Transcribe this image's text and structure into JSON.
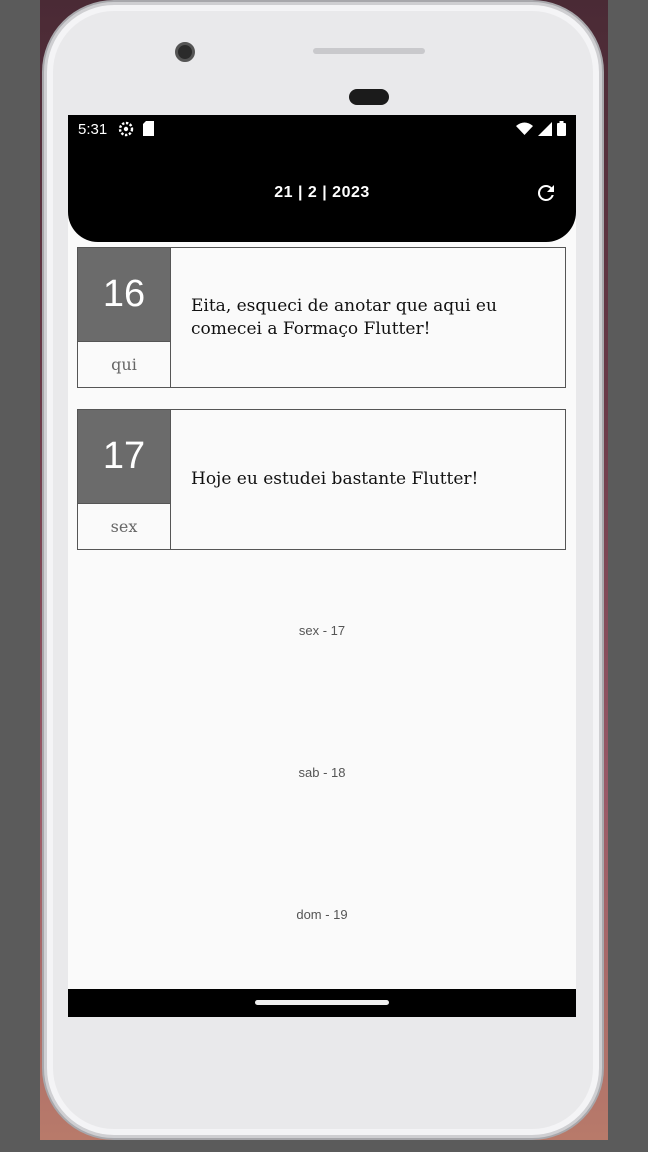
{
  "status_bar": {
    "time": "5:31"
  },
  "app_bar": {
    "title": "21  |  2  |  2023",
    "refresh_icon": "refresh-icon"
  },
  "entries": [
    {
      "day_number": "16",
      "weekday": "qui",
      "text": "Eita, esqueci de anotar que aqui eu comecei a Formaço Flutter!"
    },
    {
      "day_number": "17",
      "weekday": "sex",
      "text": "Hoje eu estudei bastante Flutter!"
    }
  ],
  "empty_days": [
    {
      "label": "sex - 17"
    },
    {
      "label": "sab - 18"
    },
    {
      "label": "dom - 19"
    }
  ],
  "colors": {
    "app_bar": "#000000",
    "day_box": "#6b6b6b",
    "background": "#fafafa"
  }
}
